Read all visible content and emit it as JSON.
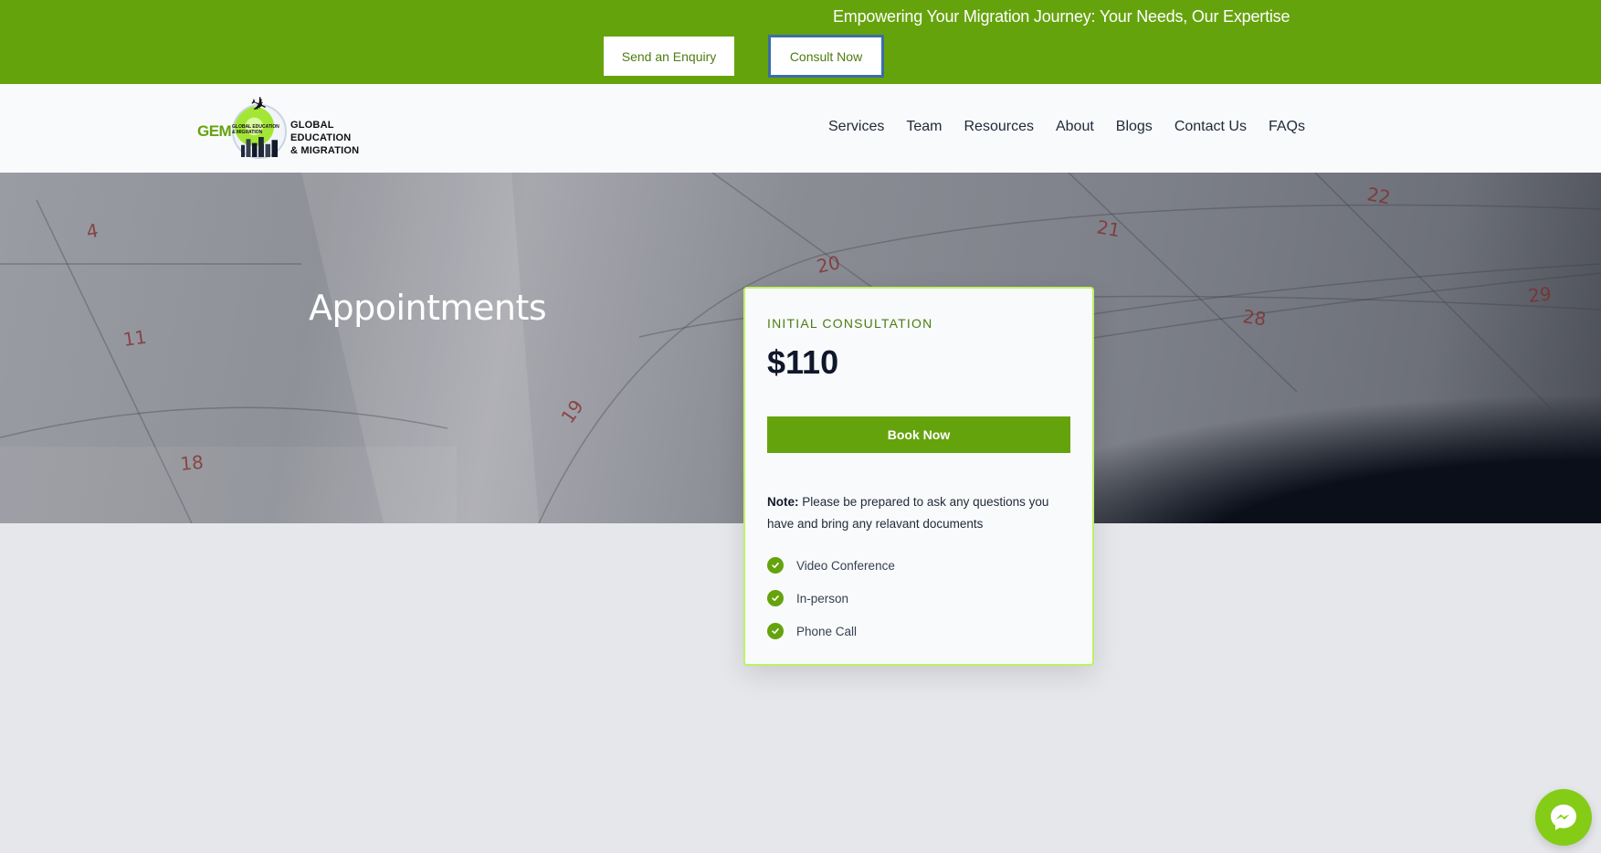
{
  "topbar": {
    "tagline": "Empowering Your Migration Journey: Your Needs, Our Expertise",
    "enquiry_label": "Send an Enquiry",
    "consult_label": "Consult Now"
  },
  "logo": {
    "short": "GEM",
    "small_text": "GLOBAL EDUCATION & MIGRATION",
    "line1": "GLOBAL",
    "line2": "EDUCATION",
    "line3": "& MIGRATION"
  },
  "nav": {
    "items": [
      {
        "label": "Services"
      },
      {
        "label": "Team"
      },
      {
        "label": "Resources"
      },
      {
        "label": "About"
      },
      {
        "label": "Blogs"
      },
      {
        "label": "Contact Us"
      },
      {
        "label": "FAQs"
      }
    ]
  },
  "hero": {
    "title": "Appointments",
    "calendar_numbers": [
      "4",
      "11",
      "18",
      "19",
      "20",
      "21",
      "22",
      "28",
      "29"
    ]
  },
  "card": {
    "label": "INITIAL CONSULTATION",
    "price": "$110",
    "book_label": "Book Now",
    "note_label": "Note:",
    "note_text": "Please be prepared to ask any questions you have and bring any relavant documents",
    "features": [
      {
        "label": "Video Conference"
      },
      {
        "label": "In-person"
      },
      {
        "label": "Phone Call"
      }
    ]
  },
  "colors": {
    "brand_green": "#65a30d",
    "card_border": "#bef264",
    "messenger": "#84cc16"
  },
  "icons": {
    "check": "check-circle-icon",
    "messenger": "messenger-icon",
    "plane": "airplane-icon"
  }
}
